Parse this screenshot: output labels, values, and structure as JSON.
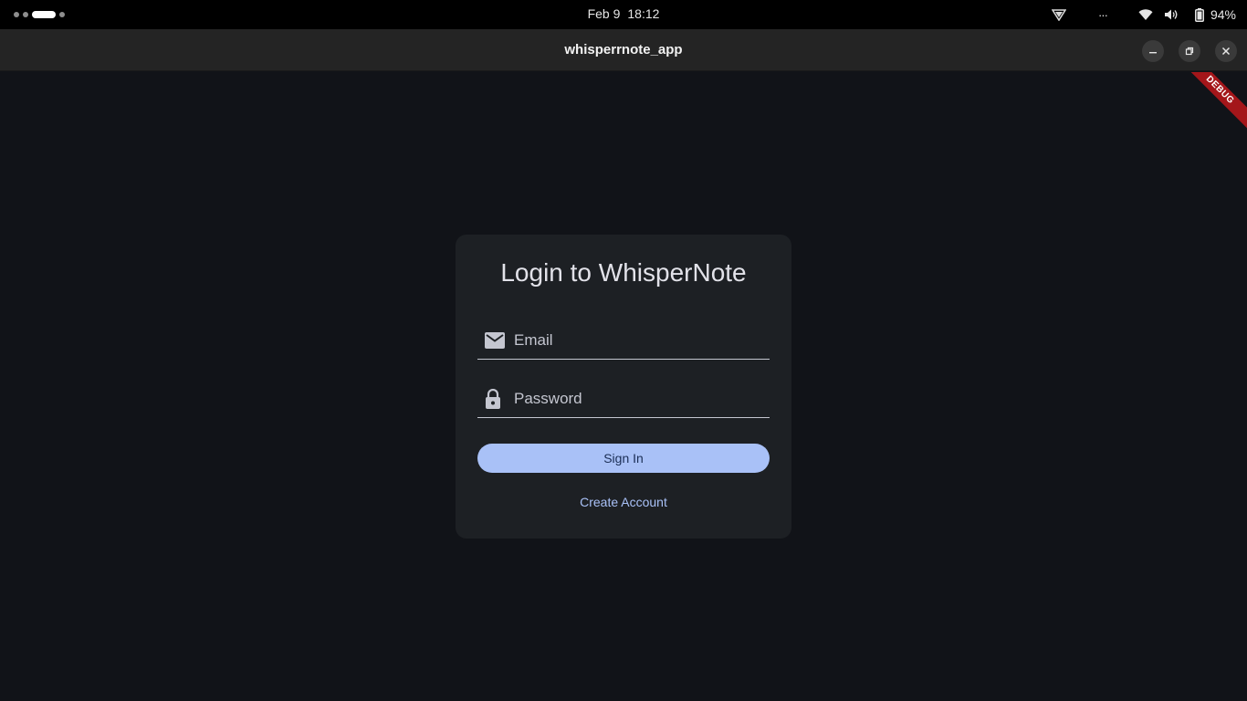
{
  "system_bar": {
    "date": "Feb 9",
    "time": "18:12",
    "overflow": "···",
    "battery": "94%",
    "icons": [
      "network-vpn-icon",
      "wifi-icon",
      "volume-icon",
      "battery-icon"
    ]
  },
  "window": {
    "title": "whisperrnote_app",
    "buttons": [
      "minimize",
      "maximize",
      "close"
    ]
  },
  "debug_banner": "DEBUG",
  "login": {
    "title": "Login to WhisperNote",
    "email_placeholder": "Email",
    "password_placeholder": "Password",
    "sign_in": "Sign In",
    "create_account": "Create Account"
  },
  "colors": {
    "background": "#111318",
    "card": "#1d2024",
    "primary": "#a9c1f7",
    "on_primary": "#1b2e55",
    "debug": "#a4161a"
  }
}
